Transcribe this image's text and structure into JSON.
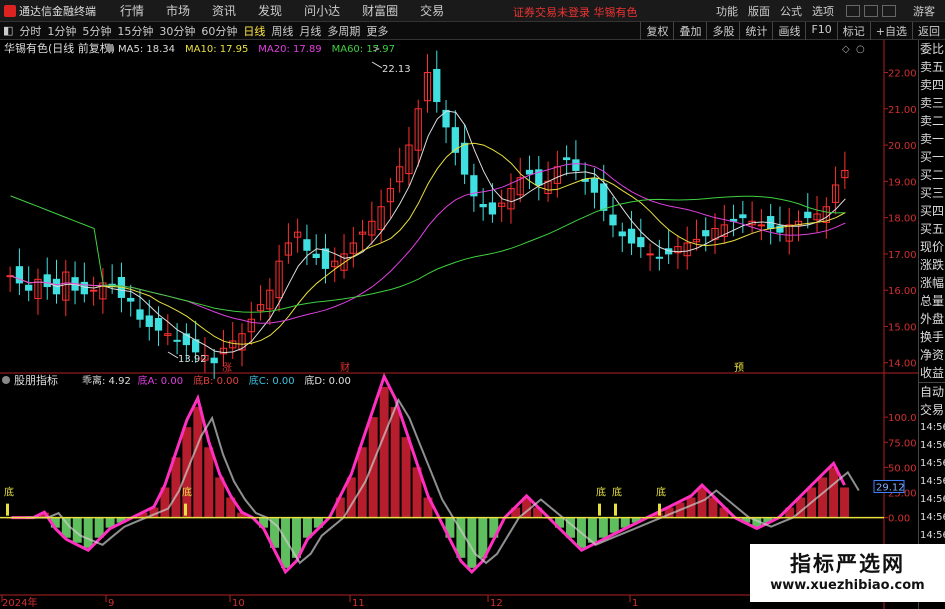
{
  "app": {
    "title": "通达信金融终端"
  },
  "menu": [
    "行情",
    "市场",
    "资讯",
    "发现",
    "问小达",
    "财富圈",
    "交易"
  ],
  "notice": "证券交易未登录 华锡有色",
  "right_menu": [
    "功能",
    "版面",
    "公式",
    "选项"
  ],
  "guest": "游客",
  "toolbar": {
    "timeframes": [
      "分时",
      "1分钟",
      "5分钟",
      "15分钟",
      "30分钟",
      "60分钟",
      "日线",
      "周线",
      "月线",
      "多周期",
      "更多"
    ],
    "active": "日线",
    "right": [
      "复权",
      "叠加",
      "多股",
      "统计",
      "画线",
      "F10",
      "标记",
      "+自选",
      "返回"
    ]
  },
  "stock": {
    "label": "华锡有色(日线 前复权)",
    "ma": [
      {
        "text": "MA5: 18.34",
        "color": "#dddddd"
      },
      {
        "text": "MA10: 17.95",
        "color": "#e8e040"
      },
      {
        "text": "MA20: 17.89",
        "color": "#e040e0"
      },
      {
        "text": "MA60: 17.97",
        "color": "#40d040"
      }
    ]
  },
  "indicator": {
    "name": "股朋指标",
    "values": [
      {
        "text": "乖离: 4.92",
        "color": "#dddddd"
      },
      {
        "text": "底A: 0.00",
        "color": "#e040e0"
      },
      {
        "text": "底B: 0.00",
        "color": "#e04040"
      },
      {
        "text": "底C: 0.00",
        "color": "#40c0e0"
      },
      {
        "text": "底D: 0.00",
        "color": "#e0e0e0"
      }
    ],
    "current": "29.12",
    "bottom_label": "底"
  },
  "price_axis": [
    "22.00",
    "21.00",
    "20.00",
    "19.00",
    "18.00",
    "17.00",
    "16.00",
    "15.00",
    "14.00"
  ],
  "ind_axis": [
    "100.0",
    "75.00",
    "50.00",
    "25.00",
    "0.00"
  ],
  "annotations": {
    "high": "22.13",
    "low": "13.92",
    "marks": [
      "涨",
      "财",
      "预"
    ]
  },
  "dates": [
    "2024年",
    "9",
    "10",
    "11",
    "12",
    "1"
  ],
  "sidebar": {
    "upper": [
      "委比",
      "卖五",
      "卖四",
      "卖三",
      "卖二",
      "卖一",
      "买一",
      "买二",
      "买三",
      "买四",
      "买五",
      "现价",
      "涨跌",
      "涨幅",
      "总量",
      "外盘",
      "换手",
      "净资",
      "收益"
    ],
    "lower": [
      "自动",
      "交易",
      "14:56",
      "14:56",
      "14:56",
      "14:56",
      "14:56",
      "14:56",
      "14:56",
      "14:56"
    ]
  },
  "watermark": {
    "line1": "指标严选网",
    "line2": "www.xuezhibiao.com"
  },
  "chart_data": {
    "type": "candlestick",
    "y_axis": {
      "min": 14.0,
      "max": 22.0
    },
    "ohlc_close_approx": [
      16.4,
      16.2,
      16.0,
      16.3,
      16.1,
      15.9,
      16.5,
      16.0,
      15.9,
      16.0,
      16.2,
      16.1,
      15.8,
      15.7,
      15.2,
      15.0,
      14.9,
      14.8,
      14.6,
      14.5,
      14.3,
      14.2,
      14.0,
      14.4,
      14.6,
      14.8,
      15.2,
      15.6,
      16.0,
      16.8,
      17.3,
      17.6,
      17.1,
      16.9,
      16.6,
      16.8,
      17.0,
      17.3,
      17.6,
      17.9,
      18.3,
      18.8,
      19.4,
      20.0,
      21.0,
      22.0,
      21.2,
      20.5,
      19.8,
      19.2,
      18.6,
      18.3,
      18.1,
      18.4,
      18.8,
      19.1,
      19.2,
      18.9,
      19.0,
      19.4,
      19.6,
      19.3,
      19.0,
      18.7,
      18.2,
      17.8,
      17.5,
      17.3,
      17.2,
      17.0,
      16.9,
      17.0,
      17.2,
      17.3,
      17.4,
      17.5,
      17.7,
      17.8,
      17.9,
      18.0,
      17.9,
      17.8,
      17.7,
      17.6,
      17.8,
      17.9,
      18.0,
      18.1,
      18.3,
      18.9,
      19.3
    ],
    "indicator_values_approx": [
      0,
      0,
      0,
      5,
      -10,
      -20,
      -25,
      -30,
      -20,
      -10,
      -5,
      0,
      5,
      10,
      30,
      60,
      90,
      110,
      70,
      40,
      20,
      5,
      0,
      -10,
      -30,
      -50,
      -40,
      -20,
      -10,
      0,
      20,
      40,
      70,
      100,
      130,
      110,
      80,
      50,
      20,
      0,
      -20,
      -40,
      -50,
      -40,
      -20,
      0,
      10,
      20,
      10,
      0,
      -10,
      -20,
      -30,
      -25,
      -20,
      -15,
      -10,
      -5,
      0,
      5,
      10,
      15,
      20,
      30,
      20,
      10,
      0,
      -5,
      -10,
      -5,
      0,
      10,
      20,
      30,
      40,
      50,
      30
    ],
    "ind_axis": {
      "min": -75,
      "max": 125
    }
  }
}
